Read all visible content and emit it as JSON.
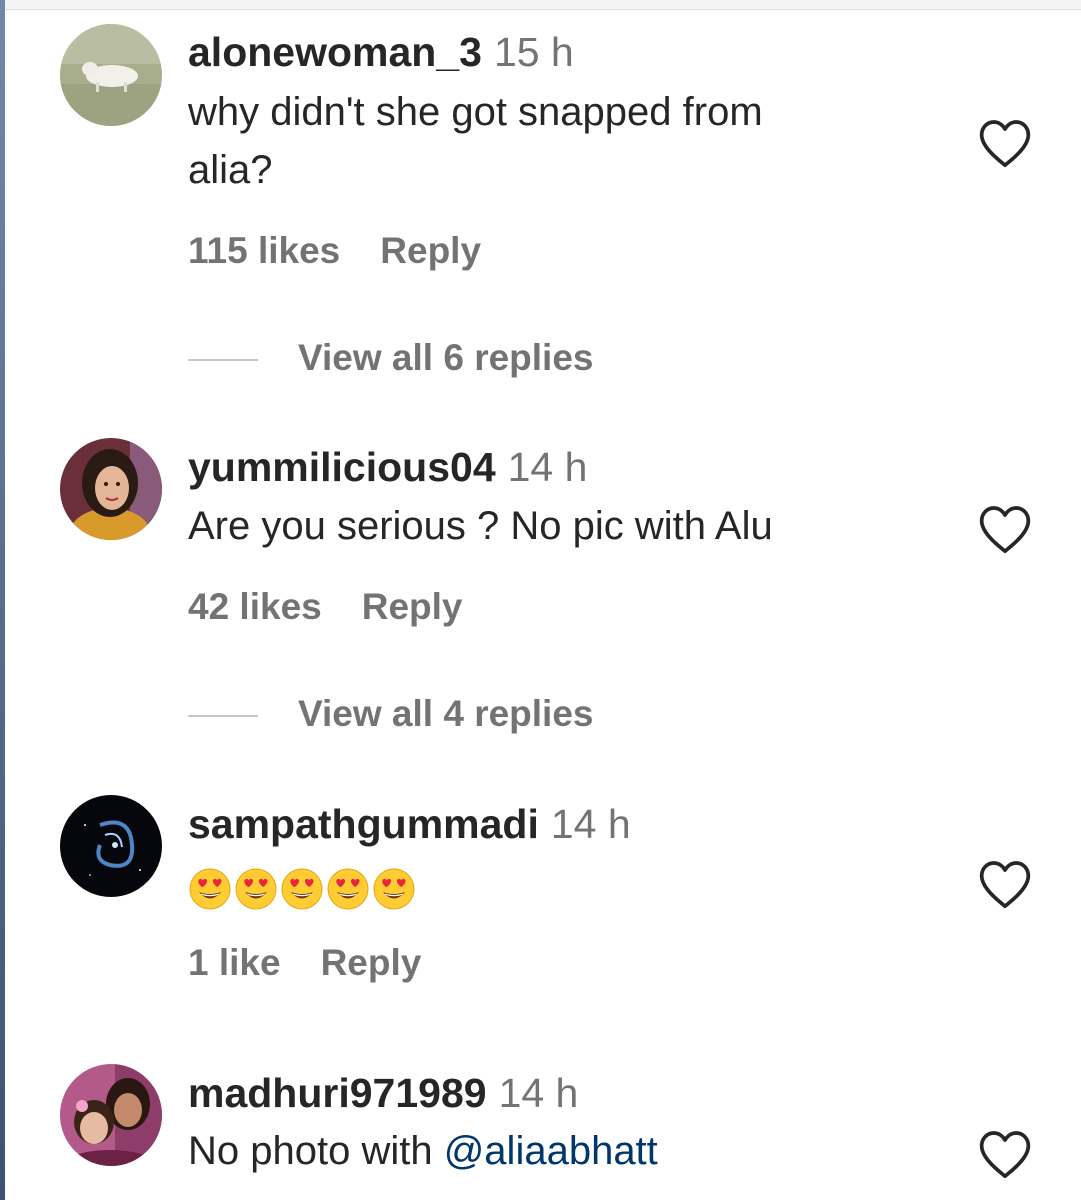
{
  "comments": [
    {
      "username": "alonewoman_3",
      "time": "15 h",
      "text_line1": "why didn't she got snapped from",
      "text_line2": "alia?",
      "likes": "115 likes",
      "reply": "Reply",
      "view_replies": "View all 6 replies",
      "avatar": "white-cow-on-grass"
    },
    {
      "username": "yummilicious04",
      "time": "14 h",
      "text_line1": "Are you serious ? No pic with Alu",
      "likes": "42 likes",
      "reply": "Reply",
      "view_replies": "View all 4 replies",
      "avatar": "woman-portrait"
    },
    {
      "username": "sampathgummadi",
      "time": "14 h",
      "emoji": "heart-eyes-face",
      "emoji_count": 5,
      "likes": "1 like",
      "reply": "Reply",
      "avatar": "galaxy-dark"
    },
    {
      "username": "madhuri971989",
      "time": "14 h",
      "text_prefix": "No photo with ",
      "mention": "@aliaabhatt",
      "avatar": "mother-child-portrait"
    }
  ],
  "icons": {
    "like": "heart-outline-icon"
  },
  "colors": {
    "username": "#262626",
    "meta": "#737373",
    "mention": "#00376b",
    "divider": "#c7c7c7"
  }
}
